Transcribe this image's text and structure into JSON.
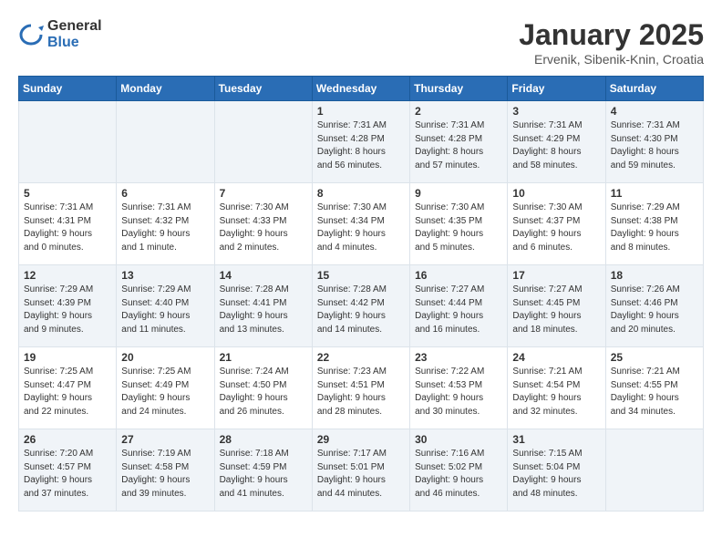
{
  "header": {
    "logo_general": "General",
    "logo_blue": "Blue",
    "title": "January 2025",
    "subtitle": "Ervenik, Sibenik-Knin, Croatia"
  },
  "days_of_week": [
    "Sunday",
    "Monday",
    "Tuesday",
    "Wednesday",
    "Thursday",
    "Friday",
    "Saturday"
  ],
  "weeks": [
    {
      "days": [
        {
          "num": "",
          "info": ""
        },
        {
          "num": "",
          "info": ""
        },
        {
          "num": "",
          "info": ""
        },
        {
          "num": "1",
          "info": "Sunrise: 7:31 AM\nSunset: 4:28 PM\nDaylight: 8 hours\nand 56 minutes."
        },
        {
          "num": "2",
          "info": "Sunrise: 7:31 AM\nSunset: 4:28 PM\nDaylight: 8 hours\nand 57 minutes."
        },
        {
          "num": "3",
          "info": "Sunrise: 7:31 AM\nSunset: 4:29 PM\nDaylight: 8 hours\nand 58 minutes."
        },
        {
          "num": "4",
          "info": "Sunrise: 7:31 AM\nSunset: 4:30 PM\nDaylight: 8 hours\nand 59 minutes."
        }
      ]
    },
    {
      "days": [
        {
          "num": "5",
          "info": "Sunrise: 7:31 AM\nSunset: 4:31 PM\nDaylight: 9 hours\nand 0 minutes."
        },
        {
          "num": "6",
          "info": "Sunrise: 7:31 AM\nSunset: 4:32 PM\nDaylight: 9 hours\nand 1 minute."
        },
        {
          "num": "7",
          "info": "Sunrise: 7:30 AM\nSunset: 4:33 PM\nDaylight: 9 hours\nand 2 minutes."
        },
        {
          "num": "8",
          "info": "Sunrise: 7:30 AM\nSunset: 4:34 PM\nDaylight: 9 hours\nand 4 minutes."
        },
        {
          "num": "9",
          "info": "Sunrise: 7:30 AM\nSunset: 4:35 PM\nDaylight: 9 hours\nand 5 minutes."
        },
        {
          "num": "10",
          "info": "Sunrise: 7:30 AM\nSunset: 4:37 PM\nDaylight: 9 hours\nand 6 minutes."
        },
        {
          "num": "11",
          "info": "Sunrise: 7:29 AM\nSunset: 4:38 PM\nDaylight: 9 hours\nand 8 minutes."
        }
      ]
    },
    {
      "days": [
        {
          "num": "12",
          "info": "Sunrise: 7:29 AM\nSunset: 4:39 PM\nDaylight: 9 hours\nand 9 minutes."
        },
        {
          "num": "13",
          "info": "Sunrise: 7:29 AM\nSunset: 4:40 PM\nDaylight: 9 hours\nand 11 minutes."
        },
        {
          "num": "14",
          "info": "Sunrise: 7:28 AM\nSunset: 4:41 PM\nDaylight: 9 hours\nand 13 minutes."
        },
        {
          "num": "15",
          "info": "Sunrise: 7:28 AM\nSunset: 4:42 PM\nDaylight: 9 hours\nand 14 minutes."
        },
        {
          "num": "16",
          "info": "Sunrise: 7:27 AM\nSunset: 4:44 PM\nDaylight: 9 hours\nand 16 minutes."
        },
        {
          "num": "17",
          "info": "Sunrise: 7:27 AM\nSunset: 4:45 PM\nDaylight: 9 hours\nand 18 minutes."
        },
        {
          "num": "18",
          "info": "Sunrise: 7:26 AM\nSunset: 4:46 PM\nDaylight: 9 hours\nand 20 minutes."
        }
      ]
    },
    {
      "days": [
        {
          "num": "19",
          "info": "Sunrise: 7:25 AM\nSunset: 4:47 PM\nDaylight: 9 hours\nand 22 minutes."
        },
        {
          "num": "20",
          "info": "Sunrise: 7:25 AM\nSunset: 4:49 PM\nDaylight: 9 hours\nand 24 minutes."
        },
        {
          "num": "21",
          "info": "Sunrise: 7:24 AM\nSunset: 4:50 PM\nDaylight: 9 hours\nand 26 minutes."
        },
        {
          "num": "22",
          "info": "Sunrise: 7:23 AM\nSunset: 4:51 PM\nDaylight: 9 hours\nand 28 minutes."
        },
        {
          "num": "23",
          "info": "Sunrise: 7:22 AM\nSunset: 4:53 PM\nDaylight: 9 hours\nand 30 minutes."
        },
        {
          "num": "24",
          "info": "Sunrise: 7:21 AM\nSunset: 4:54 PM\nDaylight: 9 hours\nand 32 minutes."
        },
        {
          "num": "25",
          "info": "Sunrise: 7:21 AM\nSunset: 4:55 PM\nDaylight: 9 hours\nand 34 minutes."
        }
      ]
    },
    {
      "days": [
        {
          "num": "26",
          "info": "Sunrise: 7:20 AM\nSunset: 4:57 PM\nDaylight: 9 hours\nand 37 minutes."
        },
        {
          "num": "27",
          "info": "Sunrise: 7:19 AM\nSunset: 4:58 PM\nDaylight: 9 hours\nand 39 minutes."
        },
        {
          "num": "28",
          "info": "Sunrise: 7:18 AM\nSunset: 4:59 PM\nDaylight: 9 hours\nand 41 minutes."
        },
        {
          "num": "29",
          "info": "Sunrise: 7:17 AM\nSunset: 5:01 PM\nDaylight: 9 hours\nand 44 minutes."
        },
        {
          "num": "30",
          "info": "Sunrise: 7:16 AM\nSunset: 5:02 PM\nDaylight: 9 hours\nand 46 minutes."
        },
        {
          "num": "31",
          "info": "Sunrise: 7:15 AM\nSunset: 5:04 PM\nDaylight: 9 hours\nand 48 minutes."
        },
        {
          "num": "",
          "info": ""
        }
      ]
    }
  ]
}
